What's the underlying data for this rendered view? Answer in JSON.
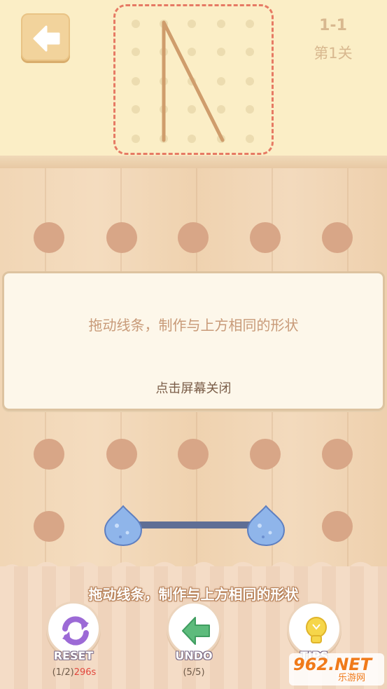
{
  "header": {
    "level_number": "1-1",
    "level_name": "第1关"
  },
  "modal": {
    "message": "拖动线条，制作与上方相同的形状",
    "close_hint": "点击屏幕关闭"
  },
  "hint_text": "拖动线条，制作与上方相同的形状",
  "tools": {
    "reset": {
      "label": "RESET",
      "count": "(1/2)",
      "timer": "296s"
    },
    "undo": {
      "label": "UNDO",
      "count": "(5/5)"
    },
    "tips": {
      "label": "TIPS"
    }
  },
  "watermark": {
    "brand": "962.NET",
    "site": "乐游网"
  },
  "colors": {
    "background": "#f3dcc0",
    "header": "#fbeec6",
    "peg": "#d8a687",
    "target_border": "#e67a64",
    "rope": "#5f6e95",
    "endpoint": "#8fb5ea",
    "timer": "#e2473d"
  },
  "icons": {
    "back": "arrow-left-icon",
    "reset": "refresh-icon",
    "undo": "arrow-left-icon",
    "tips": "lightbulb-icon"
  }
}
